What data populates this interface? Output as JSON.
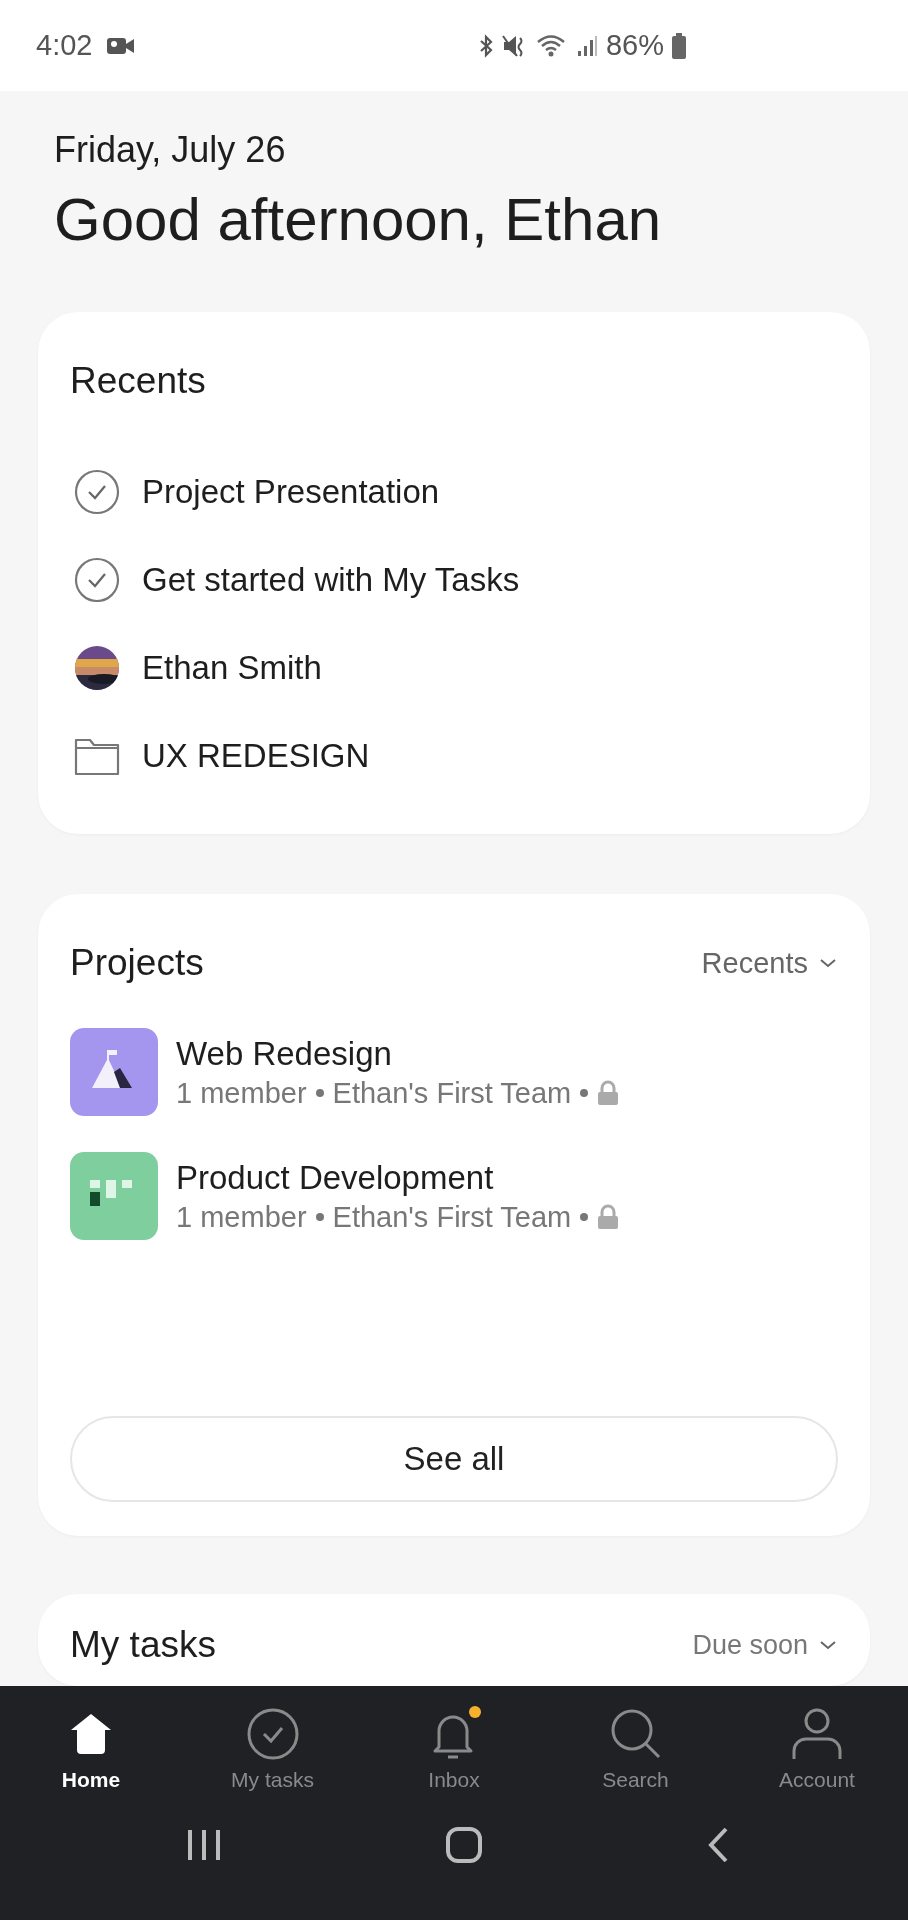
{
  "status_bar": {
    "time": "4:02",
    "battery": "86%"
  },
  "header": {
    "date": "Friday, July 26",
    "greeting": "Good afternoon, Ethan"
  },
  "recents": {
    "title": "Recents",
    "items": [
      {
        "kind": "task",
        "label": "Project Presentation"
      },
      {
        "kind": "task",
        "label": "Get started with My Tasks"
      },
      {
        "kind": "person",
        "label": "Ethan Smith"
      },
      {
        "kind": "folder",
        "label": "UX REDESIGN"
      }
    ]
  },
  "projects": {
    "title": "Projects",
    "sort": "Recents",
    "items": [
      {
        "kind": "flag",
        "color": "#a495ee",
        "name": "Web Redesign",
        "members": "1 member",
        "team": "Ethan's First Team"
      },
      {
        "kind": "board",
        "color": "#7fcf9e",
        "name": "Product Development",
        "members": "1 member",
        "team": "Ethan's First Team"
      }
    ],
    "see_all": "See all"
  },
  "my_tasks": {
    "title": "My tasks",
    "sort": "Due soon"
  },
  "nav": [
    {
      "kind": "home",
      "label": "Home",
      "selected": true
    },
    {
      "kind": "tasks",
      "label": "My tasks",
      "selected": false
    },
    {
      "kind": "inbox",
      "label": "Inbox",
      "selected": false,
      "badge": true
    },
    {
      "kind": "search",
      "label": "Search",
      "selected": false
    },
    {
      "kind": "account",
      "label": "Account",
      "selected": false
    }
  ]
}
